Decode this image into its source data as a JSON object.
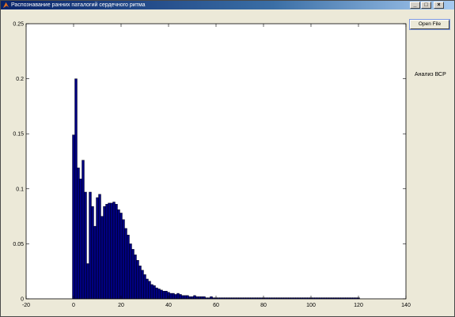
{
  "window": {
    "title": "Распознавание ранних паталогий сердечного ритма",
    "controls": {
      "minimize": "_",
      "maximize": "□",
      "close": "×"
    }
  },
  "sidebar": {
    "open_file_label": "Open File",
    "analysis_label": "Анализ ВСР"
  },
  "colors": {
    "bar_fill": "#000080",
    "bar_edge": "#000000",
    "axes_bg": "#ffffff",
    "window_bg": "#ece9d8"
  },
  "chart_data": {
    "type": "bar",
    "title": "",
    "xlabel": "",
    "ylabel": "",
    "xlim": [
      -20,
      140
    ],
    "ylim": [
      0,
      0.25
    ],
    "grid": false,
    "x_ticks": [
      -20,
      0,
      20,
      40,
      60,
      80,
      100,
      120,
      140
    ],
    "x_tick_labels": [
      "-20",
      "0",
      "20",
      "40",
      "60",
      "80",
      "100",
      "120",
      "140"
    ],
    "y_ticks": [
      0,
      0.05,
      0.1,
      0.15,
      0.2,
      0.25
    ],
    "y_tick_labels": [
      "0",
      "0.05",
      "0.1",
      "0.15",
      "0.2",
      "0.25"
    ],
    "bin_width": 1,
    "x": [
      0,
      1,
      2,
      3,
      4,
      5,
      6,
      7,
      8,
      9,
      10,
      11,
      12,
      13,
      14,
      15,
      16,
      17,
      18,
      19,
      20,
      21,
      22,
      23,
      24,
      25,
      26,
      27,
      28,
      29,
      30,
      31,
      32,
      33,
      34,
      35,
      36,
      37,
      38,
      39,
      40,
      41,
      42,
      43,
      44,
      45,
      46,
      47,
      48,
      49,
      50,
      51,
      52,
      53,
      54,
      55,
      56,
      57,
      58,
      59,
      60,
      61,
      62,
      63,
      64,
      65,
      66,
      67,
      68,
      69,
      70,
      71,
      72,
      73,
      74,
      75,
      76,
      77,
      78,
      79,
      80,
      81,
      82,
      83,
      84,
      85,
      86,
      87,
      88,
      89,
      90,
      91,
      92,
      93,
      94,
      95,
      96,
      97,
      98,
      99,
      100,
      101,
      102,
      103,
      104,
      105,
      106,
      107,
      108,
      109,
      110,
      111,
      112,
      113,
      114,
      115,
      116,
      117,
      118,
      119,
      120
    ],
    "values": [
      0.149,
      0.2,
      0.119,
      0.109,
      0.126,
      0.097,
      0.032,
      0.097,
      0.084,
      0.066,
      0.092,
      0.095,
      0.075,
      0.084,
      0.086,
      0.087,
      0.087,
      0.088,
      0.086,
      0.081,
      0.078,
      0.072,
      0.064,
      0.058,
      0.05,
      0.045,
      0.04,
      0.035,
      0.03,
      0.026,
      0.022,
      0.018,
      0.016,
      0.013,
      0.012,
      0.01,
      0.009,
      0.008,
      0.007,
      0.007,
      0.006,
      0.005,
      0.005,
      0.004,
      0.005,
      0.004,
      0.003,
      0.003,
      0.003,
      0.002,
      0.002,
      0.003,
      0.002,
      0.002,
      0.002,
      0.002,
      0.001,
      0.001,
      0.002,
      0.001,
      0.001,
      0.001,
      0.001,
      0.001,
      0.001,
      0.001,
      0.001,
      0.001,
      0.001,
      0.001,
      0.001,
      0.001,
      0.001,
      0.001,
      0.001,
      0.001,
      0.001,
      0.001,
      0.001,
      0.001,
      0.001,
      0.001,
      0.001,
      0.001,
      0.001,
      0.001,
      0.001,
      0.001,
      0.001,
      0.001,
      0.001,
      0.001,
      0.001,
      0.001,
      0.001,
      0.001,
      0.001,
      0.001,
      0.001,
      0.001,
      0.001,
      0.001,
      0.001,
      0.001,
      0.001,
      0.001,
      0.001,
      0.001,
      0.001,
      0.001,
      0.001,
      0.001,
      0.001,
      0.001,
      0.001,
      0.001,
      0.001,
      0.001,
      0.001,
      0.001,
      0.001
    ]
  }
}
